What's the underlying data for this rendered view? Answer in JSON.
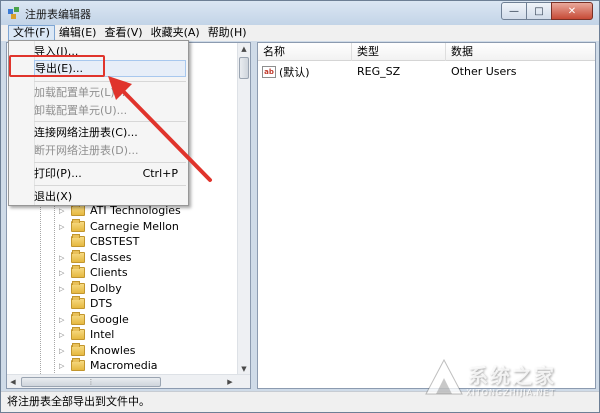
{
  "window": {
    "title": "注册表编辑器"
  },
  "window_controls": {
    "minimize": "—",
    "maximize": "□",
    "close": "✕"
  },
  "menubar": [
    "文件(F)",
    "编辑(E)",
    "查看(V)",
    "收藏夹(A)",
    "帮助(H)"
  ],
  "file_menu": {
    "items": [
      {
        "label": "导入(I)...",
        "disabled": false,
        "shortcut": ""
      },
      {
        "label": "导出(E)...",
        "disabled": false,
        "shortcut": ""
      },
      {
        "label": "加载配置单元(L)...",
        "disabled": true,
        "shortcut": ""
      },
      {
        "label": "卸载配置单元(U)...",
        "disabled": true,
        "shortcut": ""
      },
      {
        "label": "连接网络注册表(C)...",
        "disabled": false,
        "shortcut": ""
      },
      {
        "label": "断开网络注册表(D)...",
        "disabled": true,
        "shortcut": ""
      },
      {
        "label": "打印(P)...",
        "disabled": false,
        "shortcut": "Ctrl+P"
      },
      {
        "label": "退出(X)",
        "disabled": false,
        "shortcut": ""
      }
    ]
  },
  "tree": {
    "items": [
      {
        "label": "ATI Technologies",
        "expandable": true
      },
      {
        "label": "Carnegie Mellon",
        "expandable": true
      },
      {
        "label": "CBSTEST",
        "expandable": false
      },
      {
        "label": "Classes",
        "expandable": true
      },
      {
        "label": "Clients",
        "expandable": true
      },
      {
        "label": "Dolby",
        "expandable": true
      },
      {
        "label": "DTS",
        "expandable": false
      },
      {
        "label": "Google",
        "expandable": true
      },
      {
        "label": "Intel",
        "expandable": true
      },
      {
        "label": "Knowles",
        "expandable": true
      },
      {
        "label": "Macromedia",
        "expandable": true
      }
    ]
  },
  "list": {
    "columns": [
      "名称",
      "类型",
      "数据"
    ],
    "rows": [
      {
        "name": "(默认)",
        "type": "REG_SZ",
        "data": "Other Users",
        "icon": "ab-string-icon"
      }
    ]
  },
  "statusbar": {
    "text": "将注册表全部导出到文件中。"
  },
  "watermark": {
    "text": "系统之家",
    "sub": "XITONGZHIJIA.NET"
  },
  "colors": {
    "annotation": "#e0342c",
    "menu_hover": "#e7eef8"
  }
}
